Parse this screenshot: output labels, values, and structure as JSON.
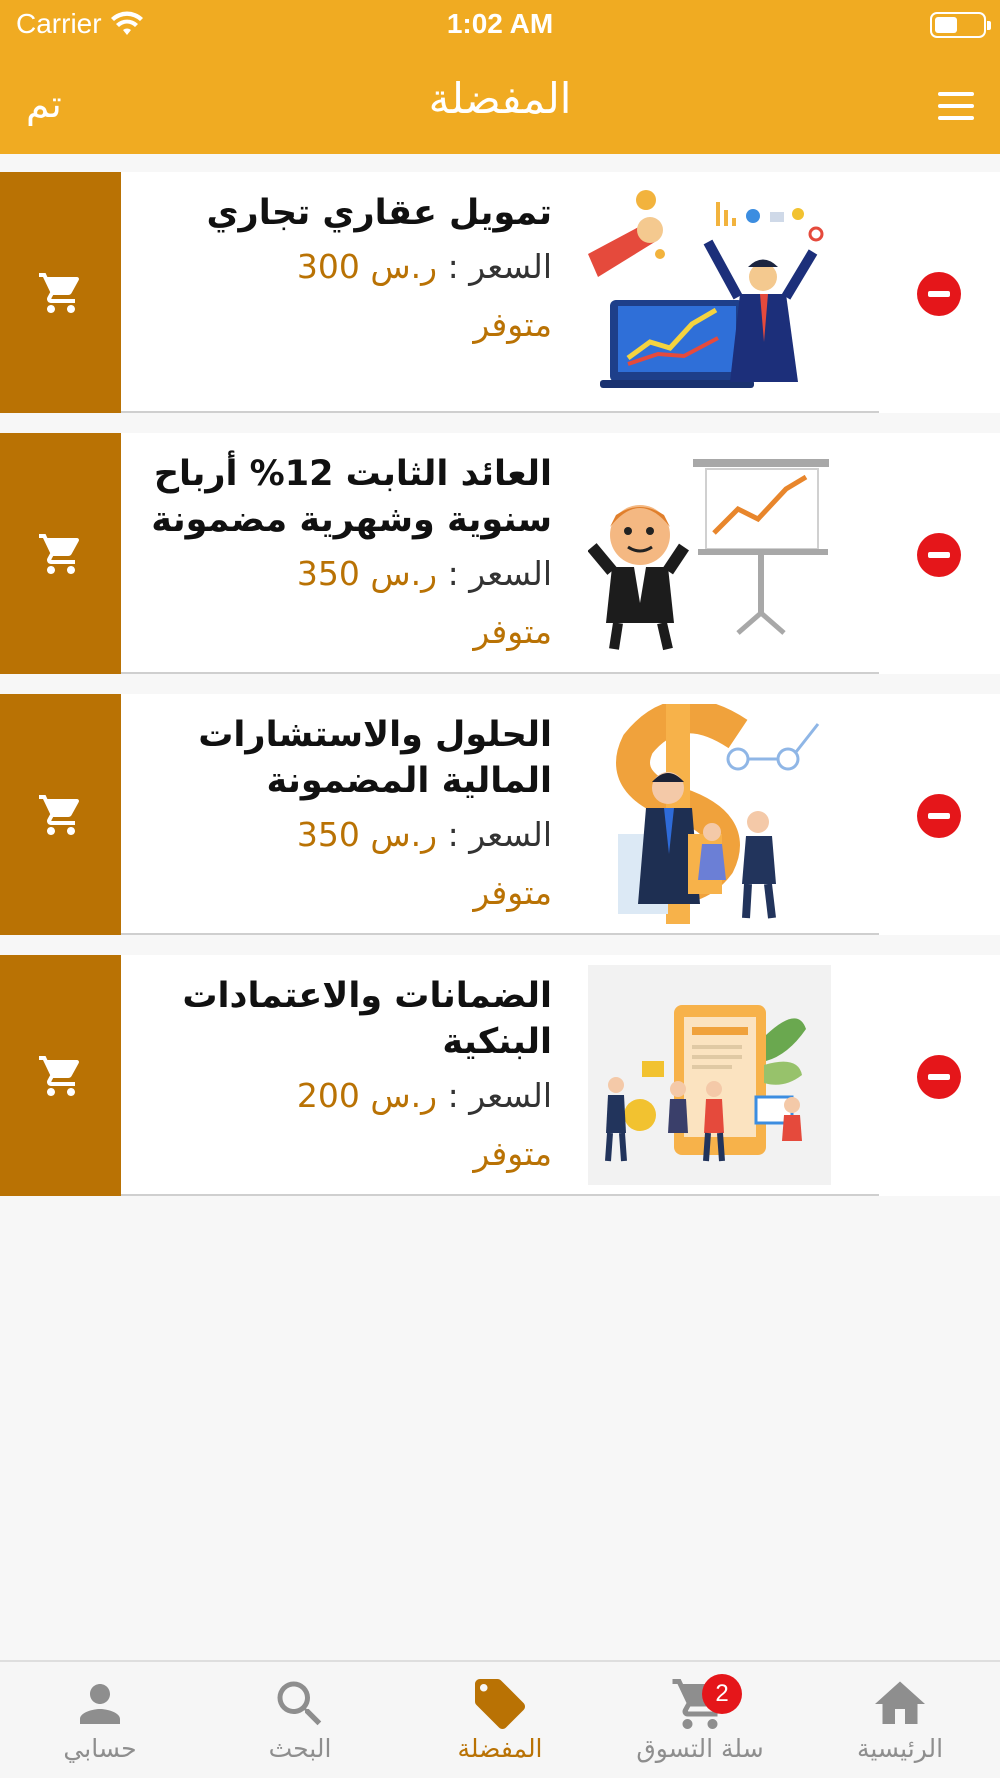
{
  "status_bar": {
    "carrier": "Carrier",
    "time": "1:02 AM"
  },
  "nav": {
    "title": "المفضلة",
    "done_label": "تم",
    "menu_icon": "menu-icon"
  },
  "colors": {
    "accent": "#f0ab22",
    "cart_button": "#b97204",
    "remove": "#e5161a"
  },
  "favorites": [
    {
      "title": "تمويل عقاري تجاري",
      "price_label": "السعر :",
      "price": "ر.س 300",
      "availability": "متوفر",
      "image": "finance-growth-illustration"
    },
    {
      "title": "العائد الثابت 12% أرباح سنوية وشهرية مضمونة",
      "price_label": "السعر :",
      "price": "ر.س 350",
      "availability": "متوفر",
      "image": "presentation-chart-illustration"
    },
    {
      "title": "الحلول والاستشارات المالية المضمونة",
      "price_label": "السعر :",
      "price": "ر.س 350",
      "availability": "متوفر",
      "image": "dollar-consulting-illustration"
    },
    {
      "title": "الضمانات والاعتمادات البنكية",
      "price_label": "السعر :",
      "price": "ر.س 200",
      "availability": "متوفر",
      "image": "banking-team-illustration"
    }
  ],
  "tabbar": {
    "tabs": [
      {
        "label": "حسابي",
        "icon": "person-icon"
      },
      {
        "label": "البحث",
        "icon": "search-icon"
      },
      {
        "label": "المفضلة",
        "icon": "tag-icon"
      },
      {
        "label": "سلة التسوق",
        "icon": "cart-icon",
        "badge": "2"
      },
      {
        "label": "الرئيسية",
        "icon": "home-icon"
      }
    ],
    "active_index": 2
  }
}
